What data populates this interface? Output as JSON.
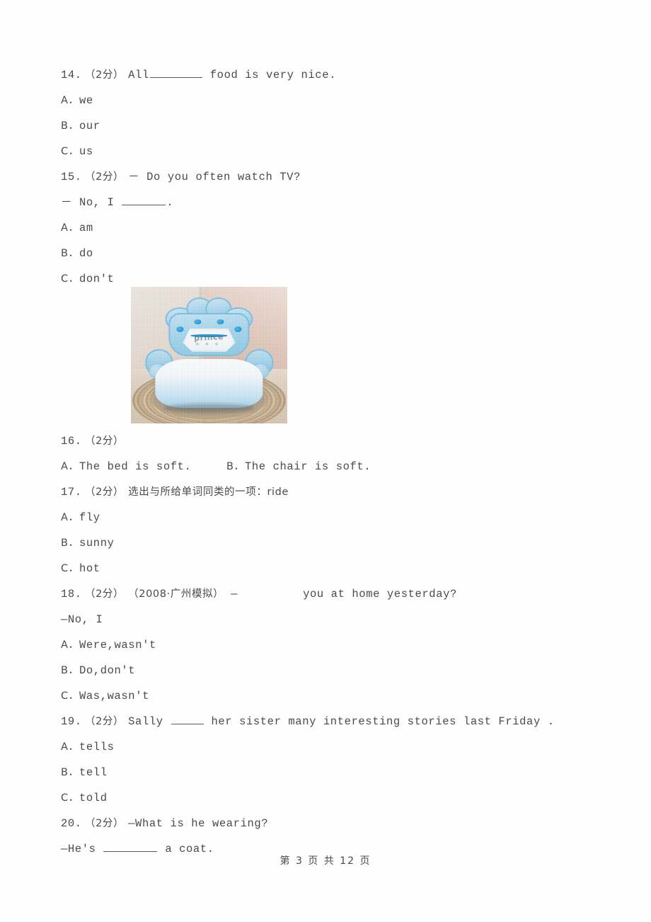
{
  "page": {
    "footer": "第 3 页 共 12 页"
  },
  "questions": [
    {
      "number": "14.",
      "points": "（2分）",
      "stem_before": "All",
      "stem_blank": true,
      "stem_after": "food is very nice.",
      "options": [
        {
          "label": "A．",
          "text": "we"
        },
        {
          "label": "B．",
          "text": "our"
        },
        {
          "label": "C．",
          "text": "us"
        }
      ]
    },
    {
      "number": "15.",
      "points": "（2分）",
      "stem": "－ Do you often watch TV?",
      "stem_line2_before": "－ No, I",
      "stem_line2_after": ".",
      "options": [
        {
          "label": "A．",
          "text": "am"
        },
        {
          "label": "B．",
          "text": "do"
        },
        {
          "label": "C．",
          "text": "don't"
        }
      ]
    },
    {
      "number": "16.",
      "points": "（2分）",
      "stem": "",
      "has_image": true,
      "image_alt": "blue plush prince crown chair on round woven rug",
      "image_caption_text": "prince",
      "options": [
        {
          "label": "A．",
          "text": "The bed is soft."
        },
        {
          "label": "B．",
          "text": "The chair is soft."
        }
      ]
    },
    {
      "number": "17.",
      "points": "（2分）",
      "stem": "选出与所给单词同类的一项：ride",
      "options": [
        {
          "label": "A．",
          "text": "fly"
        },
        {
          "label": "B．",
          "text": "sunny"
        },
        {
          "label": "C．",
          "text": "hot"
        }
      ]
    },
    {
      "number": "18.",
      "points": "（2分）",
      "source": "（2008·广州模拟）",
      "stem_dash": "—",
      "stem_after": "you at home yesterday?",
      "stem_line2": "—No, I",
      "options": [
        {
          "label": "A．",
          "text": "Were,wasn't"
        },
        {
          "label": "B．",
          "text": "Do,don't"
        },
        {
          "label": "C．",
          "text": "Was,wasn't"
        }
      ]
    },
    {
      "number": "19.",
      "points": "（2分）",
      "stem_before": "Sally",
      "stem_after": "her sister many interesting stories last Friday .",
      "options": [
        {
          "label": "A．",
          "text": "tells"
        },
        {
          "label": "B．",
          "text": "tell"
        },
        {
          "label": "C．",
          "text": "told"
        }
      ]
    },
    {
      "number": "20.",
      "points": "（2分）",
      "stem": "—What is he wearing?",
      "stem_line2_before": "—He's",
      "stem_line2_after": "a coat.",
      "options": []
    }
  ]
}
